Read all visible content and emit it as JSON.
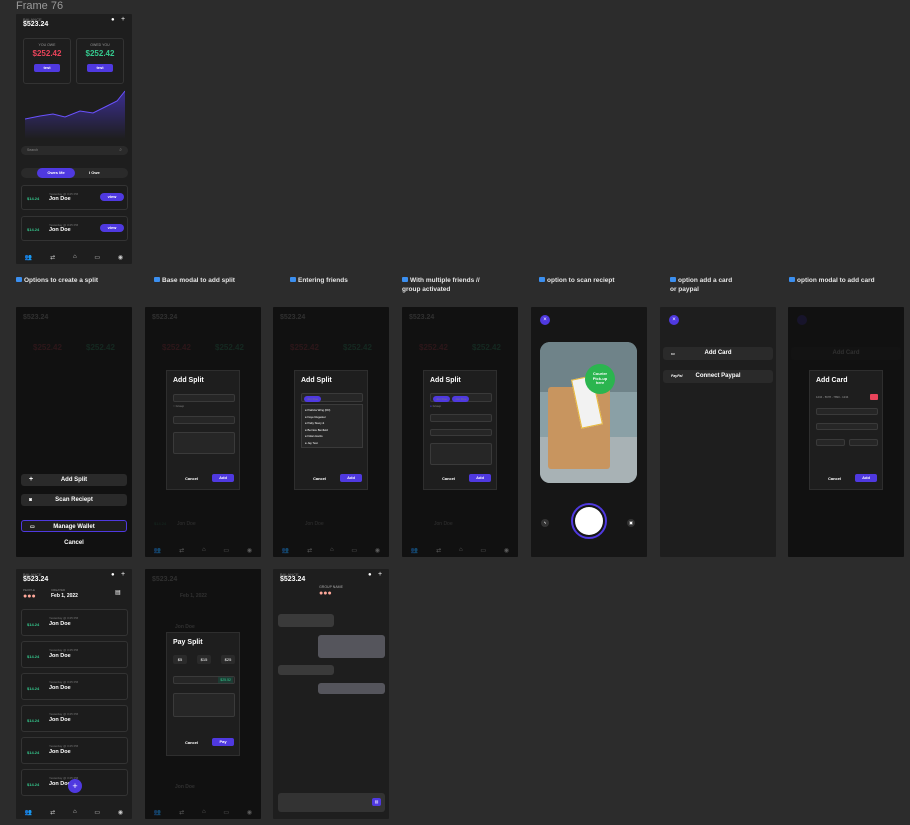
{
  "frame_title": "Frame 76",
  "common": {
    "balance_label": "BALANCE",
    "balance": "$523.24",
    "you_owe_label": "YOU OWE",
    "owed_label": "OWED YOU",
    "owe_amount": "$252.42",
    "owed_amount": "$252.42",
    "test_btn": "test",
    "search_placeholder": "Search",
    "tab_owes_me": "Owes Me",
    "tab_i_owe": "I Owe",
    "row_amount": "$14.24",
    "row_time": "Yesterday @ 3:25 PM",
    "row_name": "Jon Doe",
    "view_btn": "view",
    "cancel": "Cancel",
    "add": "Add",
    "colors": {
      "accent": "#4f39e0",
      "negative": "#e8435a",
      "positive": "#35c98e"
    }
  },
  "captions": {
    "c1": "Options to create a split",
    "c2": "Base modal to add split",
    "c3": "Entering friends",
    "c4a": "With multiple friends //",
    "c4b": "group activated",
    "c5": "option to scan reciept",
    "c6a": "option add a card",
    "c6b": "or paypal",
    "c7": "option modal to add card"
  },
  "sheet": {
    "add_split": "Add Split",
    "scan_receipt": "Scan Reciept",
    "manage_wallet": "Manage Wallet",
    "cancel": "Cancel"
  },
  "add_split_modal": {
    "title": "Add Split",
    "friends_chip": "Jon Doe",
    "chip2": "Jon Doe",
    "chip3": "Jon Doe",
    "friends": [
      "Patricia Wing (FD)",
      "Faye Regester",
      "Patty Stacy &",
      "Bernice Benfield",
      "Fidan Harris",
      "Jay Test"
    ],
    "group_label": "Group"
  },
  "scan": {
    "sticker_line1": "Courier",
    "sticker_line2": "Pick-up",
    "sticker_line3": "here"
  },
  "wallet": {
    "add_card": "Add Card",
    "paypal_logo": "PayPal",
    "connect_paypal": "Connect Paypal",
    "card_number": "1234 - 5678 - 7890 - 1234"
  },
  "group": {
    "people_label": "PEOPLE",
    "created_label": "CREATED",
    "created_date": "Feb 1, 2022",
    "group_name": "GROUP NAME"
  },
  "pay_modal": {
    "title": "Pay Split",
    "opt1": "$5",
    "opt2": "$15",
    "opt3": "$25",
    "amount": "$25.52",
    "pay": "Pay",
    "cancel": "Cancel"
  }
}
